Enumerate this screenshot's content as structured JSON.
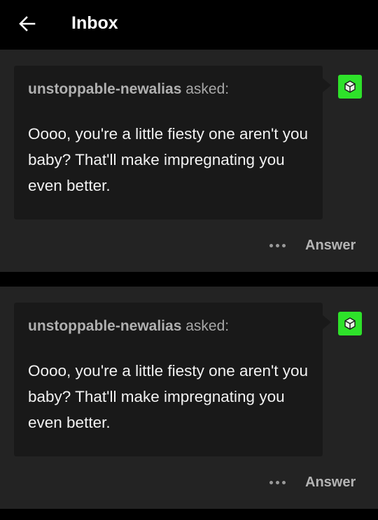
{
  "header": {
    "back_icon": "arrow-left-icon",
    "title": "Inbox"
  },
  "colors": {
    "background": "#000000",
    "card": "#232323",
    "bubble": "#191919",
    "avatar": "#2ee22a",
    "muted_text": "#a8a8a8"
  },
  "messages": [
    {
      "asker": "unstoppable-newalias",
      "asked_label": "asked:",
      "question": "Oooo, you're a little fiesty one aren't you baby? That'll make impregnating you even better.",
      "avatar_icon": "cube-avatar-icon",
      "more_icon": "more-dots-icon",
      "answer_label": "Answer"
    },
    {
      "asker": "unstoppable-newalias",
      "asked_label": "asked:",
      "question": "Oooo, you're a little fiesty one aren't you baby? That'll make impregnating you even better.",
      "avatar_icon": "cube-avatar-icon",
      "more_icon": "more-dots-icon",
      "answer_label": "Answer"
    }
  ]
}
